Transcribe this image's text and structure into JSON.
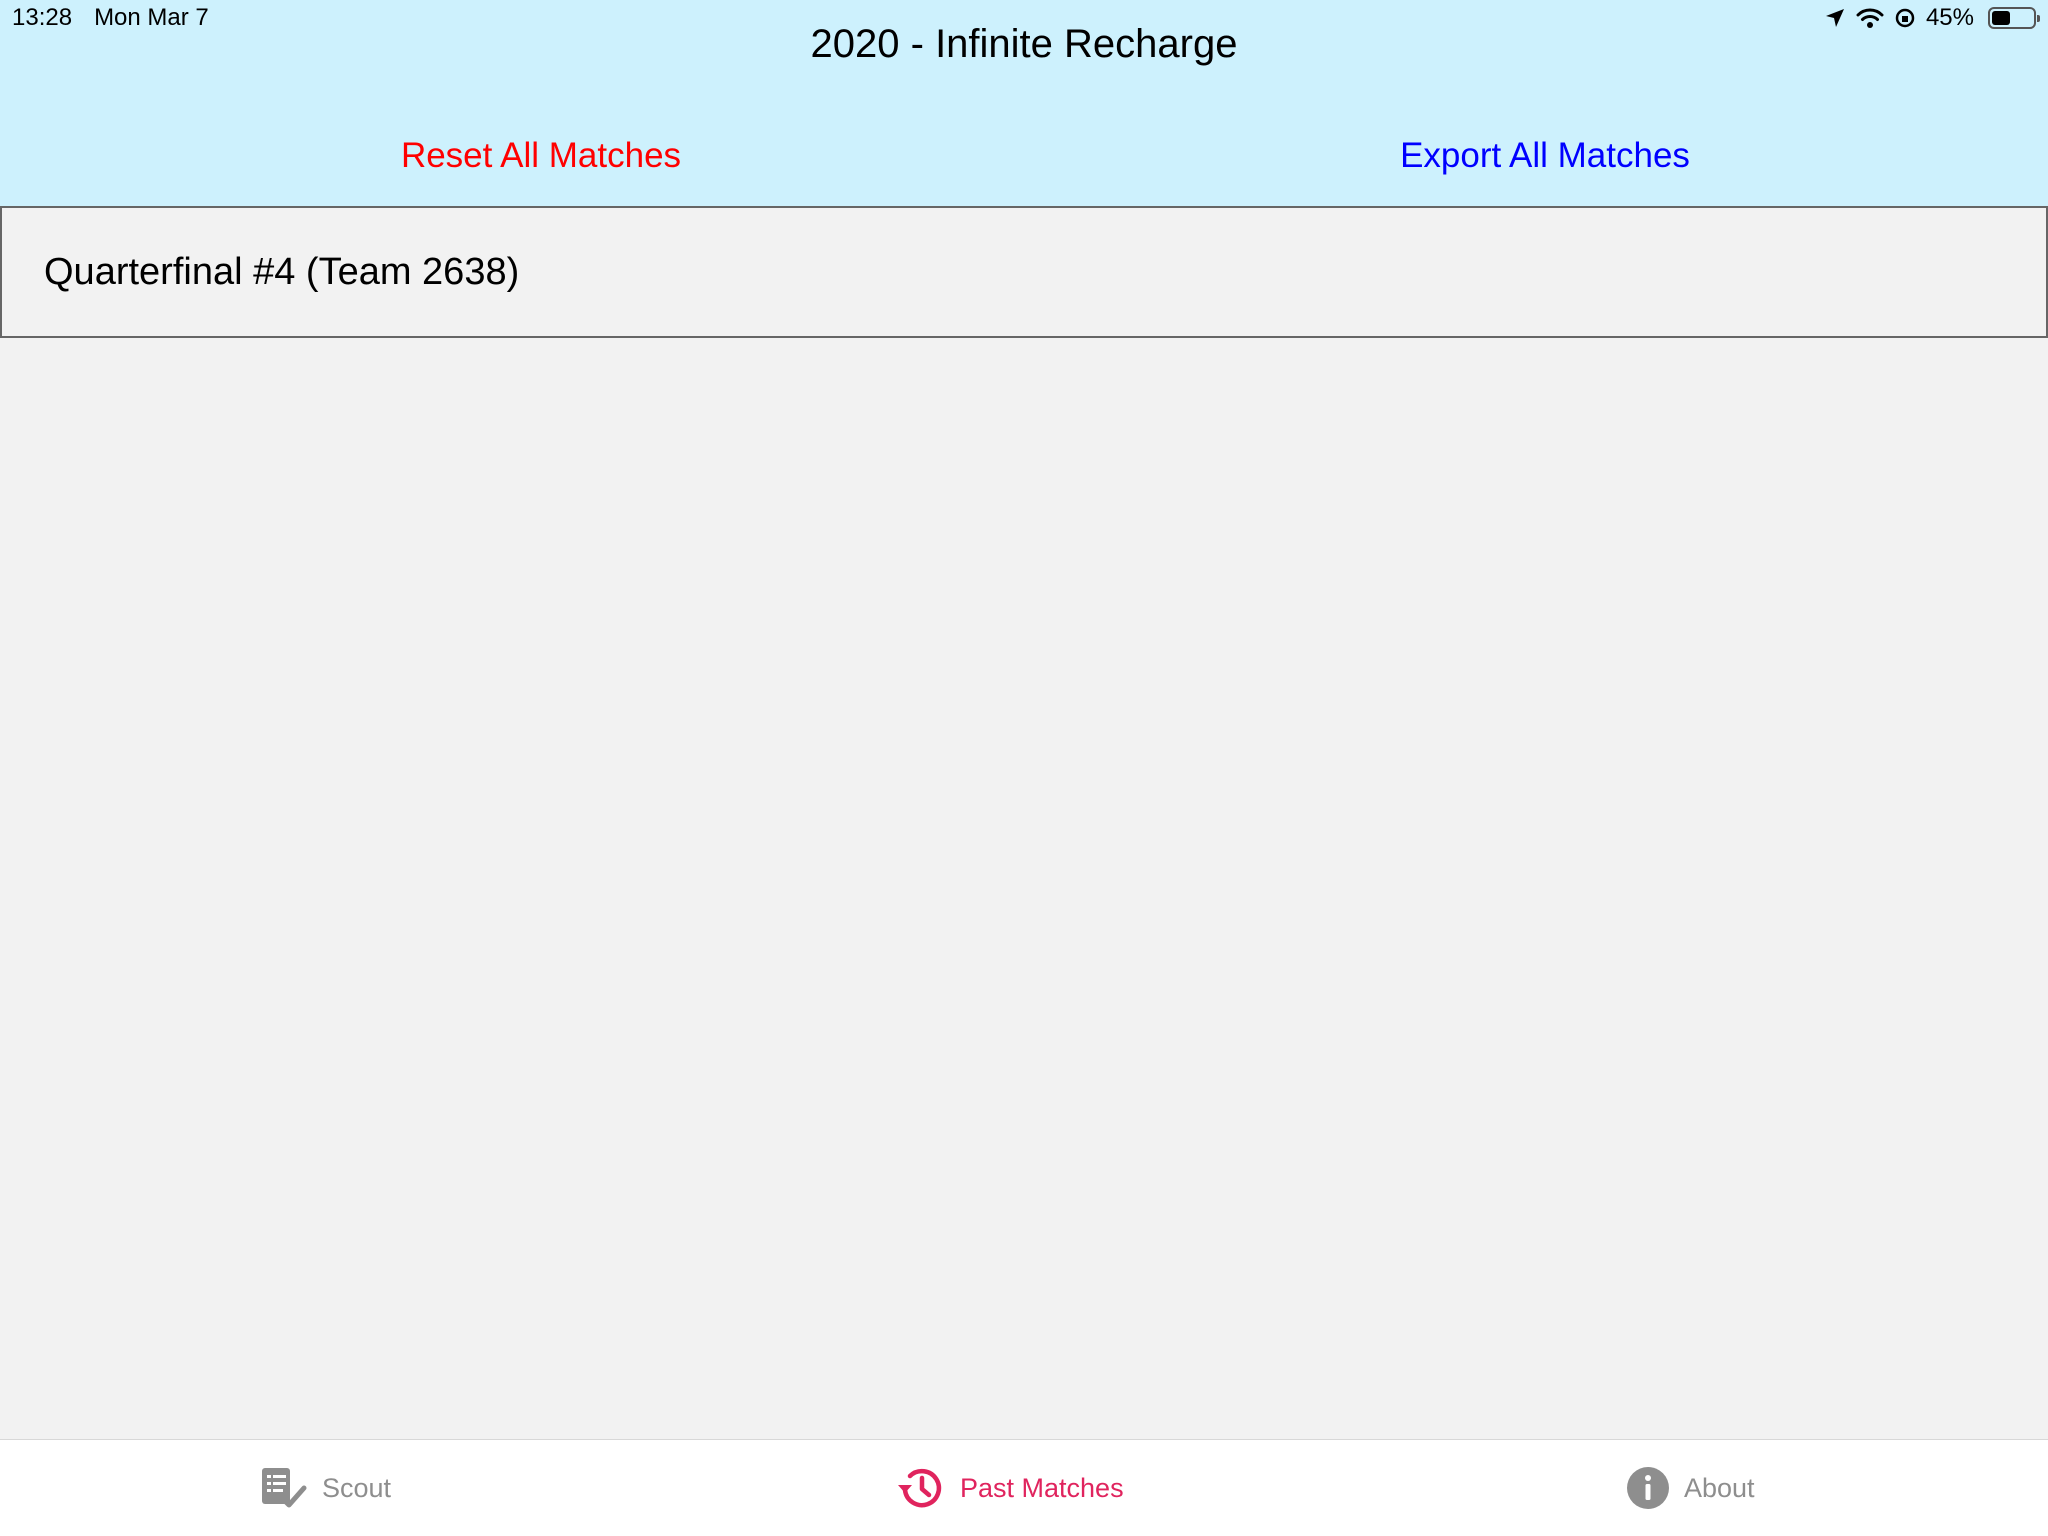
{
  "status_bar": {
    "time": "13:28",
    "date": "Mon Mar 7",
    "battery_text": "45%",
    "battery_level": 0.45
  },
  "header": {
    "title": "2020 - Infinite Recharge",
    "reset_label": "Reset All Matches",
    "export_label": "Export All Matches",
    "background_color": "#cdf1fd"
  },
  "matches": [
    {
      "label": "Quarterfinal #4 (Team 2638)"
    }
  ],
  "tabbar": {
    "active_color": "#e0245e",
    "inactive_color": "#8e8e8e",
    "tabs": [
      {
        "label": "Scout",
        "icon": "checklist-icon"
      },
      {
        "label": "Past Matches",
        "icon": "history-icon"
      },
      {
        "label": "About",
        "icon": "info-icon"
      }
    ]
  }
}
